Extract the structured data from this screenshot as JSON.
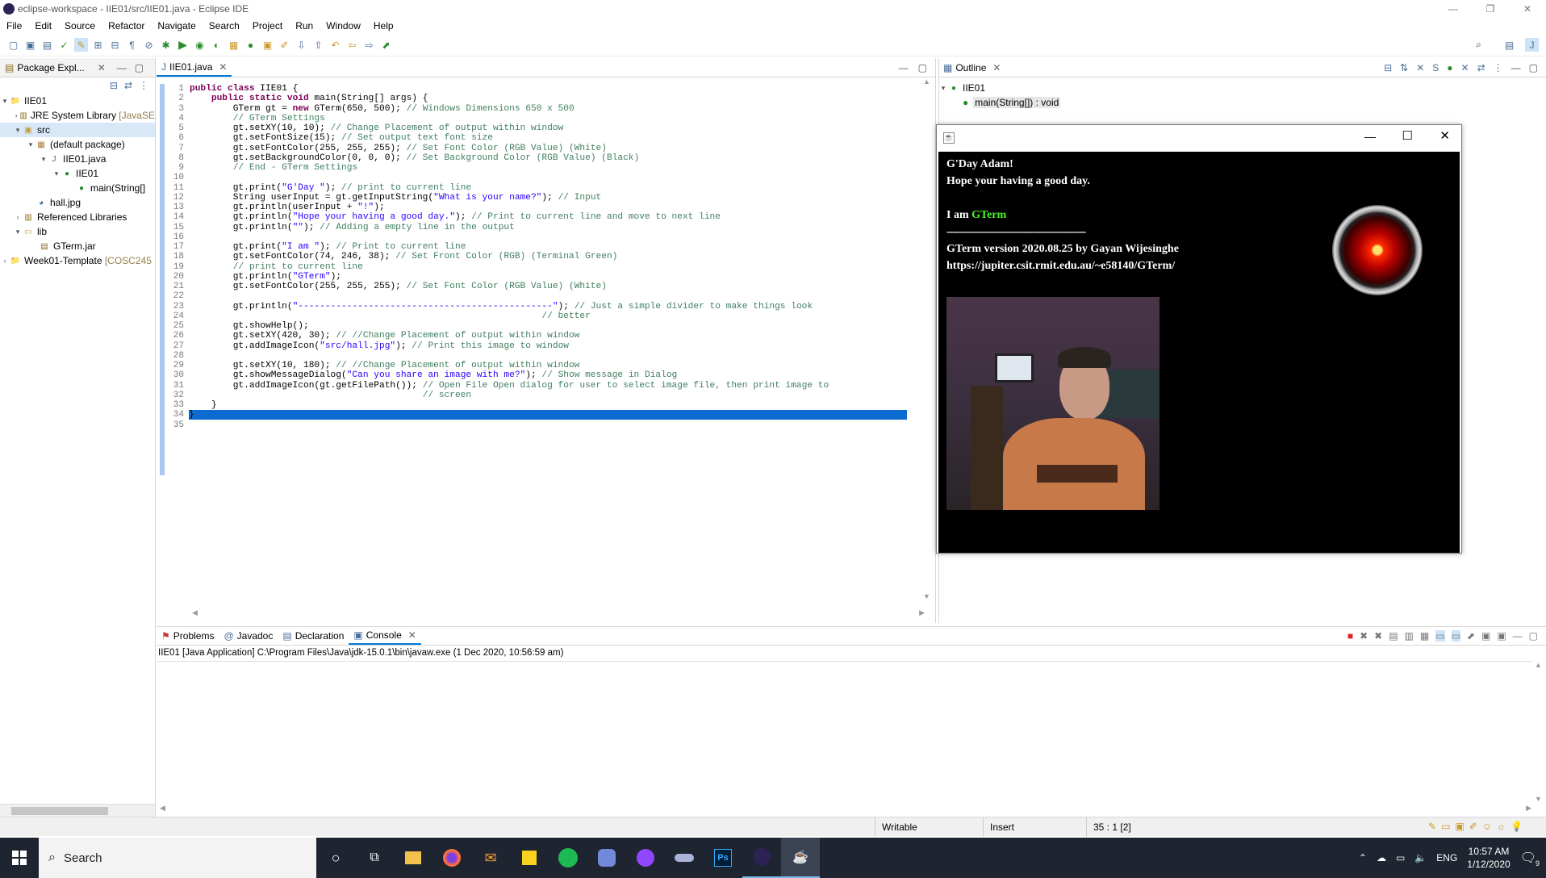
{
  "window": {
    "title": "eclipse-workspace - IIE01/src/IIE01.java - Eclipse IDE"
  },
  "menu": [
    "File",
    "Edit",
    "Source",
    "Refactor",
    "Navigate",
    "Search",
    "Project",
    "Run",
    "Window",
    "Help"
  ],
  "package_explorer": {
    "tab": "Package Expl...",
    "tree": [
      {
        "label": "IIE01",
        "suffix": "",
        "depth": 0
      },
      {
        "label": "JRE System Library",
        "suffix": "[JavaSE",
        "depth": 1
      },
      {
        "label": "src",
        "suffix": "",
        "depth": 1
      },
      {
        "label": "(default package)",
        "suffix": "",
        "depth": 2
      },
      {
        "label": "IIE01.java",
        "suffix": "",
        "depth": 3
      },
      {
        "label": "IIE01",
        "suffix": "",
        "depth": 4
      },
      {
        "label": "main(String[]",
        "suffix": "",
        "depth": 5
      },
      {
        "label": "hall.jpg",
        "suffix": "",
        "depth": 2
      },
      {
        "label": "Referenced Libraries",
        "suffix": "",
        "depth": 1
      },
      {
        "label": "lib",
        "suffix": "",
        "depth": 1
      },
      {
        "label": "GTerm.jar",
        "suffix": "",
        "depth": 2
      },
      {
        "label": "Week01-Template",
        "suffix": "[COSC245",
        "depth": 0
      }
    ]
  },
  "editor": {
    "tab": "IIE01.java",
    "lines": [
      "public class IIE01 {",
      "    public static void main(String[] args) {",
      "        GTerm gt = new GTerm(650, 500); // Windows Dimensions 650 x 500",
      "        // GTerm Settings",
      "        gt.setXY(10, 10); // Change Placement of output within window",
      "        gt.setFontSize(15); // Set output text font size",
      "        gt.setFontColor(255, 255, 255); // Set Font Color (RGB Value) (White)",
      "        gt.setBackgroundColor(0, 0, 0); // Set Background Color (RGB Value) (Black)",
      "        // End - GTerm Settings",
      "",
      "        gt.print(\"G'Day \"); // print to current line",
      "        String userInput = gt.getInputString(\"What is your name?\"); // Input",
      "        gt.println(userInput + \"!\");",
      "        gt.println(\"Hope your having a good day.\"); // Print to current line and move to next line",
      "        gt.println(\"\"); // Adding a empty line in the output",
      "",
      "        gt.print(\"I am \"); // Print to current line",
      "        gt.setFontColor(74, 246, 38); // Set Front Color (RGB) (Terminal Green)",
      "        // print to current line",
      "        gt.println(\"GTerm\");",
      "        gt.setFontColor(255, 255, 255); // Set Font Color (RGB Value) (White)",
      "",
      "        gt.println(\"-----------------------------------------------\"); // Just a simple divider to make things look",
      "                                                                 // better",
      "        gt.showHelp();",
      "        gt.setXY(420, 30); // //Change Placement of output within window",
      "        gt.addImageIcon(\"src/hall.jpg\"); // Print this image to window",
      "",
      "        gt.setXY(10, 180); // //Change Placement of output within window",
      "        gt.showMessageDialog(\"Can you share an image with me?\"); // Show message in Dialog",
      "        gt.addImageIcon(gt.getFilePath()); // Open File Open dialog for user to select image file, then print image to",
      "                                           // screen",
      "    }",
      "}",
      ""
    ]
  },
  "outline": {
    "tab": "Outline",
    "class": "IIE01",
    "method": "main(String[]) : void"
  },
  "gterm": {
    "lines": [
      {
        "text": "G'Day Adam!",
        "color": "#ffffff"
      },
      {
        "text": "Hope your having a good day.",
        "color": "#ffffff"
      },
      {
        "text": "",
        "color": "#ffffff"
      },
      {
        "text": "I am ",
        "color": "#ffffff",
        "extra": "GTerm",
        "extra_color": "#4af626"
      },
      {
        "text": "-----------------------------------------------",
        "color": "#ffffff"
      },
      {
        "text": "GTerm version 2020.08.25 by Gayan Wijesinghe",
        "color": "#ffffff"
      },
      {
        "text": "https://jupiter.csit.rmit.edu.au/~e58140/GTerm/",
        "color": "#ffffff"
      }
    ]
  },
  "bottom": {
    "tabs": [
      "Problems",
      "Javadoc",
      "Declaration",
      "Console"
    ],
    "console_header": "IIE01 [Java Application] C:\\Program Files\\Java\\jdk-15.0.1\\bin\\javaw.exe  (1 Dec 2020, 10:56:59 am)"
  },
  "status": {
    "writable": "Writable",
    "insert": "Insert",
    "position": "35 : 1 [2]"
  },
  "taskbar": {
    "search": "Search",
    "lang": "ENG",
    "time": "10:57 AM",
    "date": "1/12/2020",
    "notif": "9"
  },
  "colors": {
    "accent": "#0078d7",
    "selection": "#0b6bd1",
    "terminal_green": "#4af626"
  }
}
